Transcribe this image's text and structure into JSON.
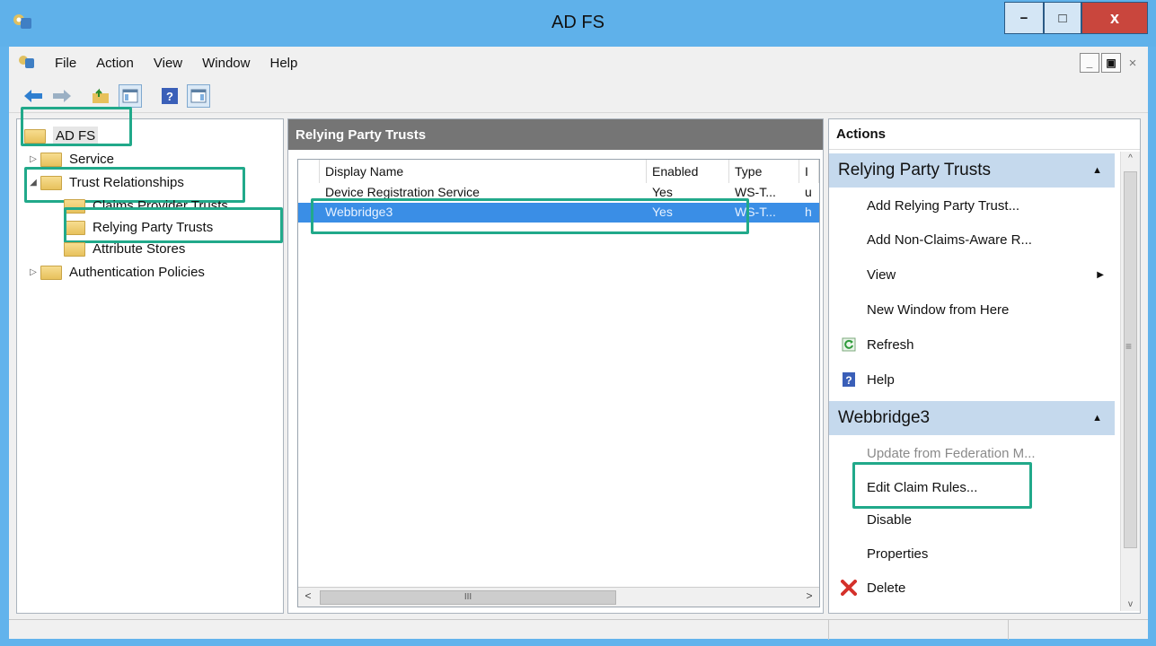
{
  "window": {
    "title": "AD FS",
    "minimize": "−",
    "maximize": "□",
    "close": "x"
  },
  "menu": {
    "items": [
      "File",
      "Action",
      "View",
      "Window",
      "Help"
    ]
  },
  "mdi": {
    "minimize": "_",
    "restore": "▣",
    "close": "×"
  },
  "tree": {
    "root": "AD FS",
    "items": [
      {
        "label": "Service",
        "expander": "▷"
      },
      {
        "label": "Trust Relationships",
        "expander": "◢"
      },
      {
        "label": "Claims Provider Trusts",
        "expander": ""
      },
      {
        "label": "Relying Party Trusts",
        "expander": ""
      },
      {
        "label": "Attribute Stores",
        "expander": ""
      },
      {
        "label": "Authentication Policies",
        "expander": "▷"
      }
    ]
  },
  "list": {
    "header": "Relying Party Trusts",
    "columns": [
      "Display Name",
      "Enabled",
      "Type",
      "I"
    ],
    "rows": [
      {
        "name": "Device Registration Service",
        "enabled": "Yes",
        "type": "WS-T...",
        "extra": "u"
      },
      {
        "name": "Webbridge3",
        "enabled": "Yes",
        "type": "WS-T...",
        "extra": "h"
      }
    ],
    "scroll_left": "<",
    "scroll_right": ">",
    "scroll_grip": "III"
  },
  "actions": {
    "title": "Actions",
    "section1": {
      "title": "Relying Party Trusts",
      "items": [
        {
          "label": "Add Relying Party Trust...",
          "icon": ""
        },
        {
          "label": "Add Non-Claims-Aware R...",
          "icon": ""
        },
        {
          "label": "View",
          "icon": ""
        },
        {
          "label": "New Window from Here",
          "icon": ""
        },
        {
          "label": "Refresh",
          "icon": "refresh-icon"
        },
        {
          "label": "Help",
          "icon": "help-icon"
        }
      ]
    },
    "section2": {
      "title": "Webbridge3",
      "items": [
        {
          "label": "Update from Federation M...",
          "disabled": true
        },
        {
          "label": "Edit Claim Rules..."
        },
        {
          "label": "Disable"
        },
        {
          "label": "Properties"
        },
        {
          "label": "Delete",
          "icon": "delete-icon"
        }
      ]
    },
    "caret_up": "▲",
    "view_arrow": "▶",
    "scroll_up": "^",
    "scroll_down": "v",
    "scroll_grip": "≡"
  },
  "colors": {
    "highlight": "#21a98a",
    "selection": "#3a8ee6",
    "section_header": "#c5d9ed",
    "title_bar": "#5fb1ea"
  }
}
